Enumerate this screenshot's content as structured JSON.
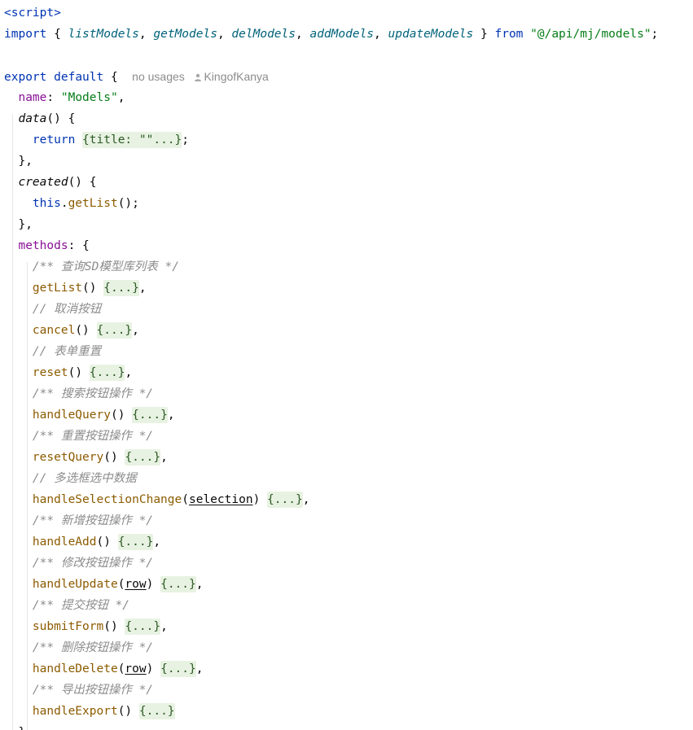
{
  "code": {
    "script_open": "<script>",
    "import_kw": "import",
    "import_open": " { ",
    "import_names": [
      "listModels",
      "getModels",
      "delModels",
      "addModels",
      "updateModels"
    ],
    "import_close": " } ",
    "from_kw": "from",
    "import_path": "\"@/api/mj/models\"",
    "export_kw": "export",
    "default_kw": "default",
    "brace_open": "{",
    "inlay_usages": "no usages",
    "inlay_author": "KingofKanya",
    "name_prop": "name",
    "name_value": "\"Models\"",
    "data_fn": "data",
    "return_kw": "return",
    "data_fold": "{title: \"\"...}",
    "created_fn": "created",
    "this_kw": "this",
    "getlist_call": "getList",
    "methods_prop": "methods",
    "fold_collapsed": "{...}",
    "methods": [
      {
        "comment": "/** 查询SD模型库列表 */",
        "name": "getList",
        "params": ""
      },
      {
        "comment": "// 取消按钮",
        "name": "cancel",
        "params": ""
      },
      {
        "comment": "// 表单重置",
        "name": "reset",
        "params": ""
      },
      {
        "comment": "/** 搜索按钮操作 */",
        "name": "handleQuery",
        "params": ""
      },
      {
        "comment": "/** 重置按钮操作 */",
        "name": "resetQuery",
        "params": ""
      },
      {
        "comment": "// 多选框选中数据",
        "name": "handleSelectionChange",
        "params": "selection"
      },
      {
        "comment": "/** 新增按钮操作 */",
        "name": "handleAdd",
        "params": ""
      },
      {
        "comment": "/** 修改按钮操作 */",
        "name": "handleUpdate",
        "params": "row"
      },
      {
        "comment": "/** 提交按钮 */",
        "name": "submitForm",
        "params": ""
      },
      {
        "comment": "/** 删除按钮操作 */",
        "name": "handleDelete",
        "params": "row"
      },
      {
        "comment": "/** 导出按钮操作 */",
        "name": "handleExport",
        "params": ""
      }
    ]
  },
  "colors": {
    "keyword": "#0033b3",
    "string": "#067d17",
    "method": "#8c5b00",
    "property": "#871094",
    "comment": "#8c8c8c",
    "fold_background": "#e8f2e2"
  }
}
